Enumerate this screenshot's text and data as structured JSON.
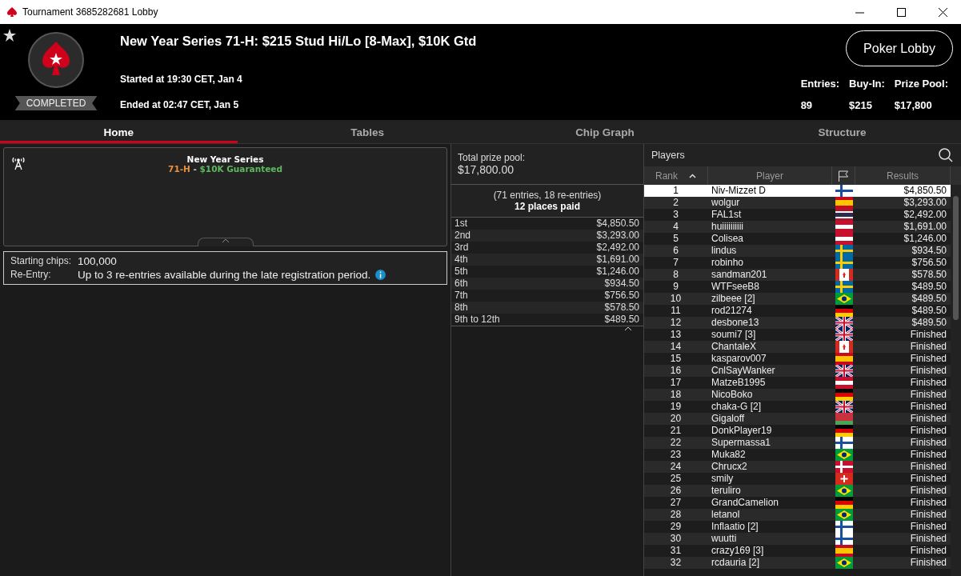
{
  "window": {
    "title": "Tournament 3685282681 Lobby"
  },
  "header": {
    "status": "COMPLETED",
    "title": "New Year Series 71-H: $215 Stud Hi/Lo [8-Max], $10K Gtd",
    "started": "Started at 19:30 CET, Jan 4",
    "ended": "Ended at 02:47 CET, Jan 5",
    "lobby_button": "Poker Lobby",
    "stats": [
      {
        "label": "Entries:",
        "value": "89"
      },
      {
        "label": "Buy-In:",
        "value": "$215"
      },
      {
        "label": "Prize Pool:",
        "value": "$17,800"
      }
    ]
  },
  "tabs": [
    {
      "label": "Home",
      "selected": true
    },
    {
      "label": "Tables",
      "selected": false
    },
    {
      "label": "Chip Graph",
      "selected": false
    },
    {
      "label": "Structure",
      "selected": false
    }
  ],
  "info_card": {
    "title": "New Year Series",
    "code": "71-H",
    "separator": "-",
    "guarantee": "$10K Guaranteed"
  },
  "details": [
    {
      "label": "Starting chips:",
      "value": "100,000",
      "info": false
    },
    {
      "label": "Re-Entry:",
      "value": "Up to 3 re-entries available during the late registration period.",
      "info": true
    }
  ],
  "prizes": {
    "total_label": "Total prize pool:",
    "total": "$17,800.00",
    "entries_note": "(71 entries, 18 re-entries)",
    "places_paid": "12 places paid",
    "payouts": [
      {
        "place": "1st",
        "amount": "$4,850.50"
      },
      {
        "place": "2nd",
        "amount": "$3,293.00"
      },
      {
        "place": "3rd",
        "amount": "$2,492.00"
      },
      {
        "place": "4th",
        "amount": "$1,691.00"
      },
      {
        "place": "5th",
        "amount": "$1,246.00"
      },
      {
        "place": "6th",
        "amount": "$934.50"
      },
      {
        "place": "7th",
        "amount": "$756.50"
      },
      {
        "place": "8th",
        "amount": "$578.50"
      },
      {
        "place": "9th to 12th",
        "amount": "$489.50"
      }
    ]
  },
  "players": {
    "title": "Players",
    "columns": [
      "Rank",
      "Player",
      "Results"
    ],
    "rows": [
      {
        "rank": "1",
        "name": "Niv-Mizzet D",
        "kind": "fi",
        "result": "$4,850.50",
        "selected": true
      },
      {
        "rank": "2",
        "name": "wolgur",
        "kind": "es",
        "result": "$3,293.00",
        "selected": false
      },
      {
        "rank": "3",
        "name": "FAL1st",
        "kind": "th",
        "result": "$2,492.00",
        "selected": false
      },
      {
        "rank": "4",
        "name": "huiiiiiiiiii",
        "kind": "at",
        "result": "$1,691.00",
        "selected": false
      },
      {
        "rank": "5",
        "name": "Colisea",
        "kind": "at",
        "result": "$1,246.00",
        "selected": false
      },
      {
        "rank": "6",
        "name": "lindus",
        "kind": "se",
        "result": "$934.50",
        "selected": false
      },
      {
        "rank": "7",
        "name": "robinho",
        "kind": "se",
        "result": "$756.50",
        "selected": false
      },
      {
        "rank": "8",
        "name": "sandman201",
        "kind": "ca",
        "result": "$578.50",
        "selected": false
      },
      {
        "rank": "9",
        "name": "WTFseeB8",
        "kind": "se",
        "result": "$489.50",
        "selected": false
      },
      {
        "rank": "10",
        "name": "zilbeee [2]",
        "kind": "br",
        "result": "$489.50",
        "selected": false
      },
      {
        "rank": "11",
        "name": "rod21274",
        "kind": "de",
        "result": "$489.50",
        "selected": false
      },
      {
        "rank": "12",
        "name": "desbone13",
        "kind": "gb",
        "result": "$489.50",
        "selected": false
      },
      {
        "rank": "13",
        "name": "soumi7 [3]",
        "kind": "gb",
        "result": "Finished",
        "selected": false
      },
      {
        "rank": "14",
        "name": "ChantaleX",
        "kind": "ca",
        "result": "Finished",
        "selected": false
      },
      {
        "rank": "15",
        "name": "kasparov007",
        "kind": "es",
        "result": "Finished",
        "selected": false
      },
      {
        "rank": "16",
        "name": "CnlSayWanker",
        "kind": "gb",
        "result": "Finished",
        "selected": false
      },
      {
        "rank": "17",
        "name": "MatzeB1995",
        "kind": "at",
        "result": "Finished",
        "selected": false
      },
      {
        "rank": "18",
        "name": "NicoBoko",
        "kind": "de",
        "result": "Finished",
        "selected": false
      },
      {
        "rank": "19",
        "name": "chaka-G [2]",
        "kind": "gb",
        "result": "Finished",
        "selected": false
      },
      {
        "rank": "20",
        "name": "Gigaloff",
        "kind": "by",
        "result": "Finished",
        "selected": false
      },
      {
        "rank": "21",
        "name": "DonkPlayer19",
        "kind": "de",
        "result": "Finished",
        "selected": false
      },
      {
        "rank": "22",
        "name": "Supermassa1",
        "kind": "fi",
        "result": "Finished",
        "selected": false
      },
      {
        "rank": "23",
        "name": "Muka82",
        "kind": "br",
        "result": "Finished",
        "selected": false
      },
      {
        "rank": "24",
        "name": "Chrucx2",
        "kind": "dk",
        "result": "Finished",
        "selected": false
      },
      {
        "rank": "25",
        "name": "smily",
        "kind": "ch",
        "result": "Finished",
        "selected": false
      },
      {
        "rank": "26",
        "name": "teruliro",
        "kind": "br",
        "result": "Finished",
        "selected": false
      },
      {
        "rank": "27",
        "name": "GrandCamelion",
        "kind": "de",
        "result": "Finished",
        "selected": false
      },
      {
        "rank": "28",
        "name": "letanol",
        "kind": "br",
        "result": "Finished",
        "selected": false
      },
      {
        "rank": "29",
        "name": "Inflaatio [2]",
        "kind": "fi",
        "result": "Finished",
        "selected": false
      },
      {
        "rank": "30",
        "name": "wuutti",
        "kind": "fi",
        "result": "Finished",
        "selected": false
      },
      {
        "rank": "31",
        "name": "crazy169 [3]",
        "kind": "es",
        "result": "Finished",
        "selected": false
      },
      {
        "rank": "32",
        "name": "rcdauria [2]",
        "kind": "br",
        "result": "Finished",
        "selected": false
      }
    ]
  }
}
